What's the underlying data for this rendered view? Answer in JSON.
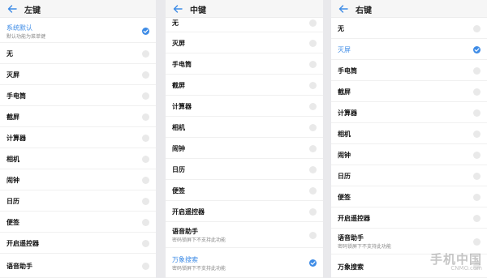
{
  "left_panel": {
    "title": "左键",
    "items": [
      {
        "label": "系统默认",
        "sub": "默认功能为菜单键",
        "selected": true
      },
      {
        "label": "无"
      },
      {
        "label": "灭屏"
      },
      {
        "label": "手电筒"
      },
      {
        "label": "截屏"
      },
      {
        "label": "计算器"
      },
      {
        "label": "相机"
      },
      {
        "label": "闹钟"
      },
      {
        "label": "日历"
      },
      {
        "label": "便签"
      },
      {
        "label": "开启遥控器"
      },
      {
        "label": "语音助手"
      }
    ]
  },
  "middle_panel": {
    "title": "中键",
    "items": [
      {
        "label": "无"
      },
      {
        "label": "灭屏"
      },
      {
        "label": "手电筒"
      },
      {
        "label": "截屏"
      },
      {
        "label": "计算器"
      },
      {
        "label": "相机"
      },
      {
        "label": "闹钟"
      },
      {
        "label": "日历"
      },
      {
        "label": "便签"
      },
      {
        "label": "开启遥控器"
      },
      {
        "label": "语音助手",
        "sub": "密码锁屏下不支持此功能"
      },
      {
        "label": "万象搜索",
        "sub": "密码锁屏下不支持此功能",
        "selected": true
      }
    ]
  },
  "right_panel": {
    "title": "右键",
    "items": [
      {
        "label": "无"
      },
      {
        "label": "灭屏",
        "selected": true
      },
      {
        "label": "手电筒"
      },
      {
        "label": "截屏"
      },
      {
        "label": "计算器"
      },
      {
        "label": "相机"
      },
      {
        "label": "闹钟"
      },
      {
        "label": "日历"
      },
      {
        "label": "便签"
      },
      {
        "label": "开启遥控器"
      },
      {
        "label": "语音助手",
        "sub": "密码锁屏下不支持此功能"
      },
      {
        "label": "万象搜索"
      }
    ]
  },
  "watermark": {
    "main": "手机中国",
    "sub": "CNMO.com"
  },
  "colors": {
    "accent": "#3d8be6",
    "radio_off": "#e9e9e9",
    "header_bg": "#f6f6f6"
  }
}
